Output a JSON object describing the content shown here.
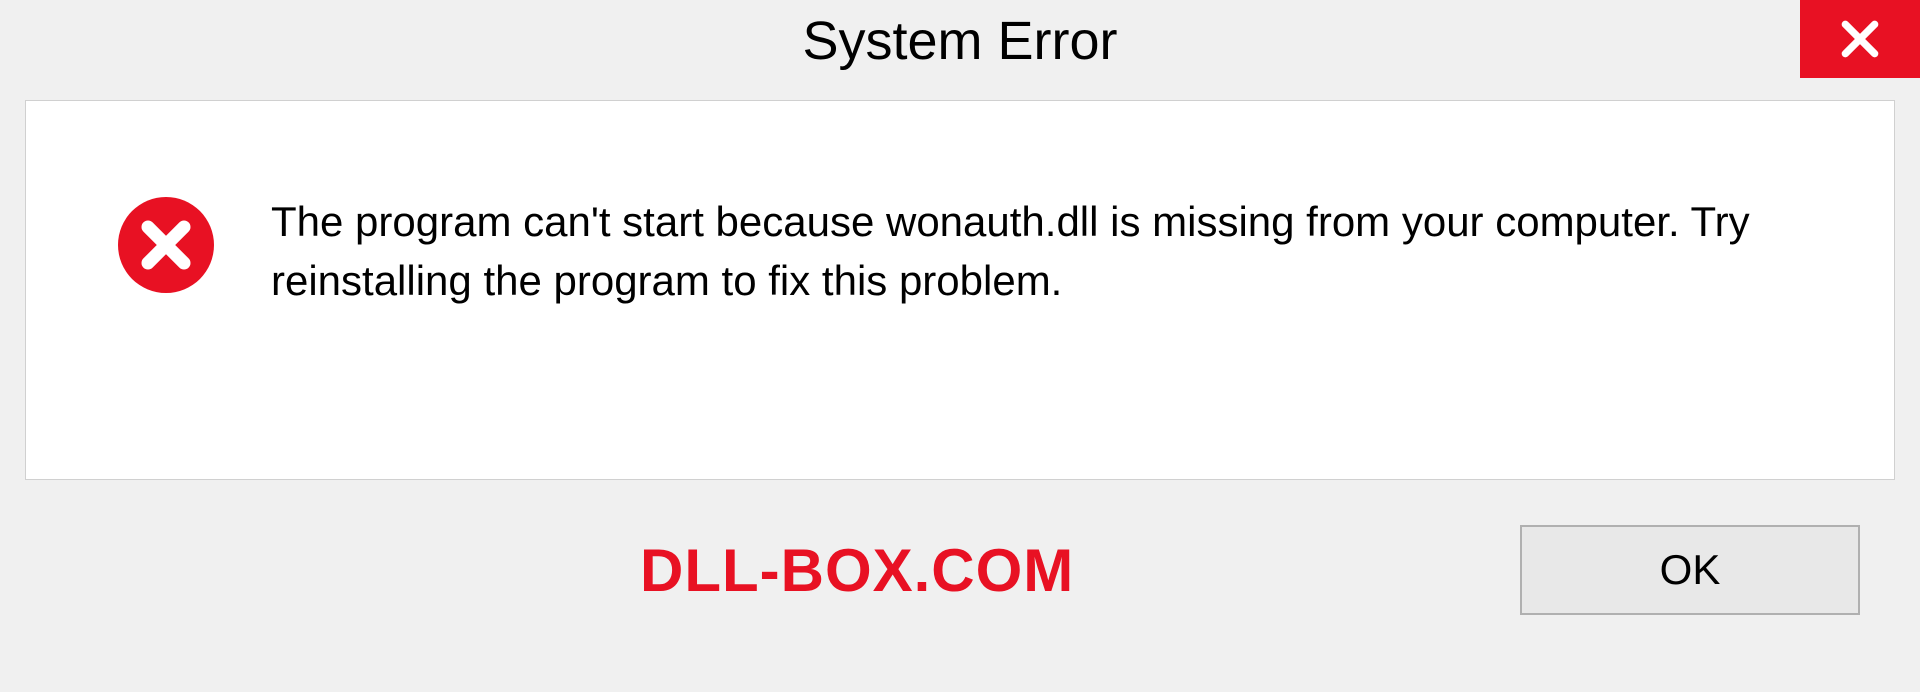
{
  "dialog": {
    "title": "System Error",
    "message": "The program can't start because wonauth.dll is missing from your computer. Try reinstalling the program to fix this problem.",
    "ok_label": "OK"
  },
  "watermark": "DLL-BOX.COM",
  "colors": {
    "accent_red": "#e81123",
    "background": "#f0f0f0",
    "content_bg": "#ffffff"
  }
}
